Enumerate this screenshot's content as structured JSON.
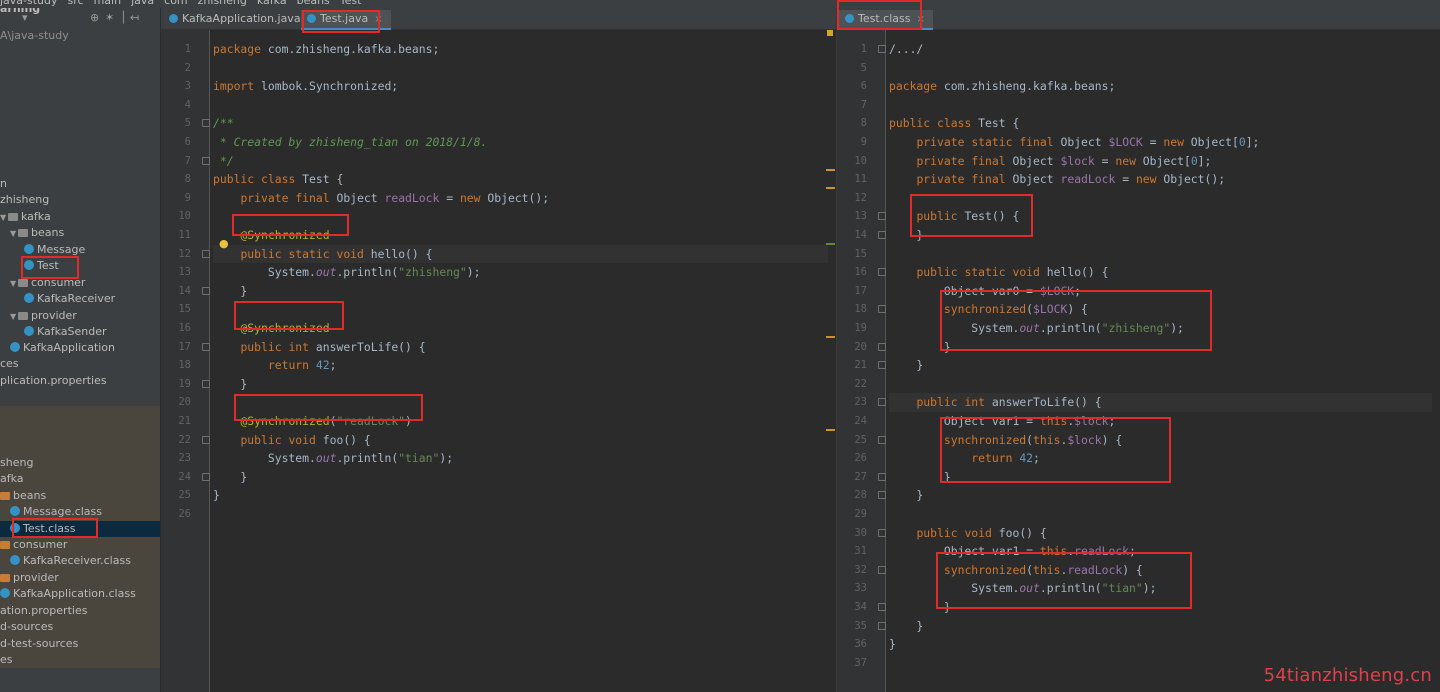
{
  "breadcrumb": [
    "java-study",
    "src",
    "main",
    "java",
    "com",
    "zhisheng",
    "kafka",
    "beans",
    "Test"
  ],
  "tree": {
    "tools": [
      "arning",
      "▾",
      "⊕",
      "✶",
      "│",
      "↤"
    ],
    "rows": [
      {
        "label": "A\\java-study"
      },
      {
        "label": "n"
      },
      {
        "label": "zhisheng"
      },
      {
        "label": "kafka"
      },
      {
        "label": "beans"
      },
      {
        "label": "Message"
      },
      {
        "label": "Test"
      },
      {
        "label": "consumer"
      },
      {
        "label": "KafkaReceiver"
      },
      {
        "label": "provider"
      },
      {
        "label": "KafkaSender"
      },
      {
        "label": "KafkaApplication"
      },
      {
        "label": "ces"
      },
      {
        "label": "plication.properties"
      },
      {
        "label": "sheng"
      },
      {
        "label": "afka"
      },
      {
        "label": "beans"
      },
      {
        "label": "Message.class"
      },
      {
        "label": "Test.class"
      },
      {
        "label": "consumer"
      },
      {
        "label": "KafkaReceiver.class"
      },
      {
        "label": "provider"
      },
      {
        "label": "KafkaApplication.class"
      },
      {
        "label": "ation.properties"
      },
      {
        "label": "d-sources"
      },
      {
        "label": "d-test-sources"
      },
      {
        "label": "es"
      }
    ]
  },
  "left_editor": {
    "tabs": [
      {
        "label": "KafkaApplication.java",
        "close": "×"
      },
      {
        "label": "Test.java",
        "close": "×"
      }
    ],
    "line_numbers": [
      "1",
      "2",
      "3",
      "4",
      "5",
      "6",
      "7",
      "8",
      "9",
      "10",
      "11",
      "12",
      "13",
      "14",
      "15",
      "16",
      "17",
      "18",
      "19",
      "20",
      "21",
      "22",
      "23",
      "24",
      "25",
      "26"
    ]
  },
  "right_editor": {
    "tabs": [
      {
        "label": "Test.class",
        "close": "×"
      }
    ],
    "line_numbers": [
      "1",
      "5",
      "6",
      "7",
      "8",
      "9",
      "10",
      "11",
      "12",
      "13",
      "14",
      "15",
      "16",
      "17",
      "18",
      "19",
      "20",
      "21",
      "22",
      "23",
      "24",
      "25",
      "26",
      "27",
      "28",
      "29",
      "30",
      "31",
      "32",
      "33",
      "34",
      "35",
      "36",
      "37"
    ]
  },
  "code_left": [
    {
      "t": "package com.zhisheng.kafka.beans;"
    },
    {
      "t": ""
    },
    {
      "t": "import lombok.Synchronized;"
    },
    {
      "t": ""
    },
    {
      "t": "/**"
    },
    {
      "t": " * Created by zhisheng_tian on 2018/1/8."
    },
    {
      "t": " */"
    },
    {
      "t": "public class Test {"
    },
    {
      "t": "    private final Object readLock = new Object();"
    },
    {
      "t": ""
    },
    {
      "t": "    @Synchronized"
    },
    {
      "t": "    public static void hello() {"
    },
    {
      "t": "        System.out.println(\"zhisheng\");"
    },
    {
      "t": "    }"
    },
    {
      "t": ""
    },
    {
      "t": "    @Synchronized"
    },
    {
      "t": "    public int answerToLife() {"
    },
    {
      "t": "        return 42;"
    },
    {
      "t": "    }"
    },
    {
      "t": ""
    },
    {
      "t": "    @Synchronized(\"readLock\")"
    },
    {
      "t": "    public void foo() {"
    },
    {
      "t": "        System.out.println(\"tian\");"
    },
    {
      "t": "    }"
    },
    {
      "t": "}"
    },
    {
      "t": ""
    }
  ],
  "code_right": [
    {
      "t": "/.../"
    },
    {
      "t": ""
    },
    {
      "t": "package com.zhisheng.kafka.beans;"
    },
    {
      "t": ""
    },
    {
      "t": "public class Test {"
    },
    {
      "t": "    private static final Object $LOCK = new Object[0];"
    },
    {
      "t": "    private final Object $lock = new Object[0];"
    },
    {
      "t": "    private final Object readLock = new Object();"
    },
    {
      "t": ""
    },
    {
      "t": "    public Test() {"
    },
    {
      "t": "    }"
    },
    {
      "t": ""
    },
    {
      "t": "    public static void hello() {"
    },
    {
      "t": "        Object var0 = $LOCK;"
    },
    {
      "t": "        synchronized($LOCK) {"
    },
    {
      "t": "            System.out.println(\"zhisheng\");"
    },
    {
      "t": "        }"
    },
    {
      "t": "    }"
    },
    {
      "t": ""
    },
    {
      "t": "    public int answerToLife() {"
    },
    {
      "t": "        Object var1 = this.$lock;"
    },
    {
      "t": "        synchronized(this.$lock) {"
    },
    {
      "t": "            return 42;"
    },
    {
      "t": "        }"
    },
    {
      "t": "    }"
    },
    {
      "t": ""
    },
    {
      "t": "    public void foo() {"
    },
    {
      "t": "        Object var1 = this.readLock;"
    },
    {
      "t": "        synchronized(this.readLock) {"
    },
    {
      "t": "            System.out.println(\"tian\");"
    },
    {
      "t": "        }"
    },
    {
      "t": "    }"
    },
    {
      "t": "}"
    },
    {
      "t": ""
    }
  ],
  "watermark": "54tianzhisheng.cn",
  "colors": {
    "highlight_box": "#e02b2b",
    "keyword": "#cc7832",
    "string": "#6a8759",
    "annotation": "#bbb529",
    "comment": "#629755",
    "number": "#6897bb",
    "background": "#2b2b2b"
  }
}
